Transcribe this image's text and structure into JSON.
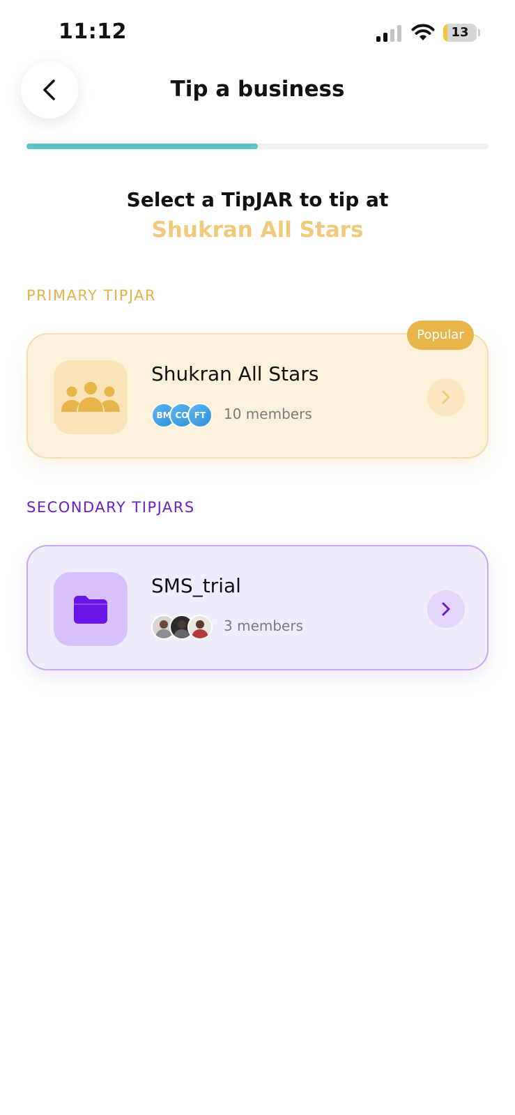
{
  "status_bar": {
    "time": "11:12",
    "battery_level": "13",
    "battery_fraction": 0.13,
    "signal_bars_active": 2,
    "signal_bars_total": 4
  },
  "header": {
    "title": "Tip a business",
    "back_icon": "chevron-left-icon"
  },
  "progress": {
    "fraction": 0.5,
    "fill_color": "#5cc3c6"
  },
  "intro": {
    "subtitle": "Select a TipJAR to tip at",
    "business_name": "Shukran All Stars"
  },
  "primary": {
    "section_label": "PRIMARY TIPJAR",
    "badge": "Popular",
    "card": {
      "name": "Shukran All Stars",
      "icon": "group-icon",
      "members_text": "10 members",
      "avatars": [
        "BM",
        "CO",
        "FT"
      ],
      "accent": "#e8b54a"
    }
  },
  "secondary": {
    "section_label": "SECONDARY TIPJARS",
    "card": {
      "name": "SMS_trial",
      "icon": "folder-icon",
      "members_text": "3 members",
      "avatars": [
        "member-photo-1",
        "member-photo-2",
        "member-photo-3"
      ],
      "accent": "#6a1fc8"
    }
  }
}
